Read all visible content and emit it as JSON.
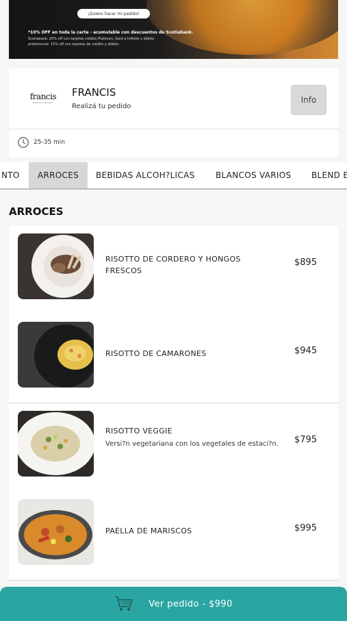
{
  "banner": {
    "cta": "¡Quiero hacer mi pedido!",
    "promo_title": "*10% OFF en toda la carta - acumulable con descuentos de Scotiabank.",
    "promo_detail": "Scotiabank: 25% off con tarjetas crédito Platinum, Gold e Infinite y débito preferencial. 15% off con tarjetas de crédito y débito."
  },
  "restaurant": {
    "logo_text": "francis",
    "logo_sub": "RESTAURANT",
    "name": "FRANCIS",
    "subtitle": "Realizá tu pedido",
    "info_label": "Info",
    "delivery_time": "25-35 min"
  },
  "tabs": [
    {
      "label": "NTO",
      "active": false
    },
    {
      "label": "ARROCES",
      "active": true
    },
    {
      "label": "BEBIDAS ALCOH?LICAS",
      "active": false
    },
    {
      "label": "BLANCOS VARIOS",
      "active": false
    },
    {
      "label": "BLEND E",
      "active": false
    }
  ],
  "section": {
    "title": "ARROCES"
  },
  "items": [
    {
      "title": "RISOTTO DE CORDERO Y HONGOS FRESCOS",
      "description": "",
      "price": "$895"
    },
    {
      "title": "RISOTTO DE CAMARONES",
      "description": "",
      "price": "$945"
    },
    {
      "title": "RISOTTO VEGGIE",
      "description": "Versi?n vegetariana con los vegetales de estaci?n.",
      "price": "$795"
    },
    {
      "title": "PAELLA DE MARISCOS",
      "description": "",
      "price": "$995"
    }
  ],
  "cart": {
    "label": "Ver pedido - $990"
  },
  "colors": {
    "accent": "#2aa6a2",
    "active_tab": "#d7d7d7"
  }
}
